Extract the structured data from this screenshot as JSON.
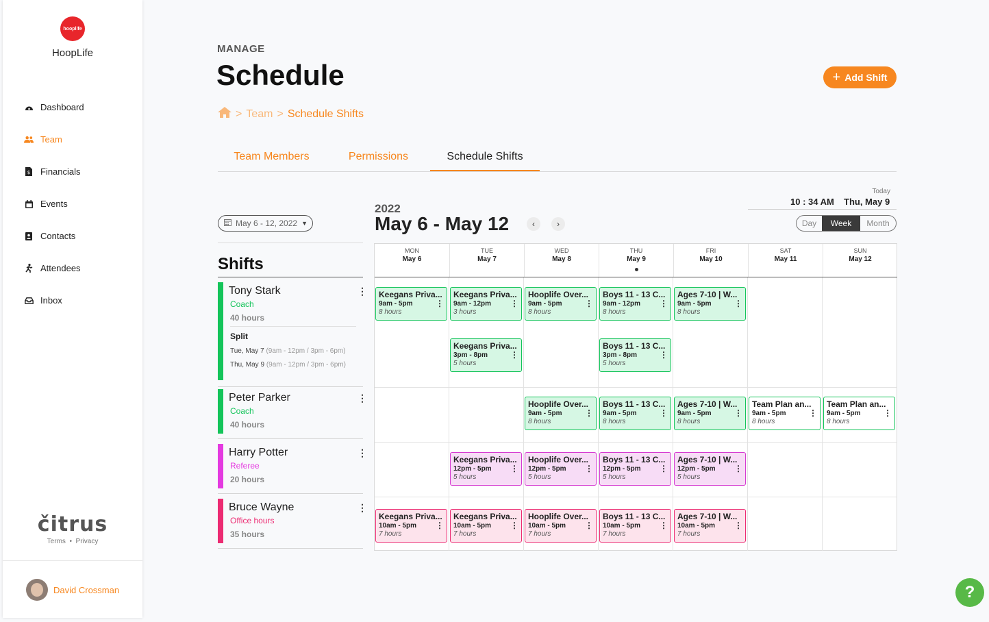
{
  "brand": {
    "logo_text": "hooplife",
    "name": "HoopLife"
  },
  "sidebar": {
    "items": [
      {
        "label": "Dashboard",
        "icon": "dashboard-icon"
      },
      {
        "label": "Team",
        "icon": "team-icon",
        "active": true
      },
      {
        "label": "Financials",
        "icon": "financials-icon"
      },
      {
        "label": "Events",
        "icon": "calendar-icon"
      },
      {
        "label": "Contacts",
        "icon": "contacts-icon"
      },
      {
        "label": "Attendees",
        "icon": "attendees-icon"
      },
      {
        "label": "Inbox",
        "icon": "inbox-icon"
      }
    ],
    "footer_logo": "čitrus",
    "terms": "Terms",
    "privacy": "Privacy",
    "user_name": "David Crossman"
  },
  "header": {
    "kicker": "MANAGE",
    "title": "Schedule",
    "add_button": "Add Shift",
    "breadcrumb": {
      "parent": "Team",
      "current": "Schedule Shifts",
      "sep": ">"
    }
  },
  "tabs": [
    "Team Members",
    "Permissions",
    "Schedule Shifts"
  ],
  "toolbar": {
    "date_picker": "May 6 - 12, 2022",
    "year": "2022",
    "range": "May 6 - May 12",
    "today_label": "Today",
    "time": "10 : 34 AM",
    "today_date": "Thu, May 9",
    "views": [
      "Day",
      "Week",
      "Month"
    ],
    "selected_view": "Week"
  },
  "shifts_panel": {
    "heading": "Shifts",
    "people": [
      {
        "name": "Tony Stark",
        "role": "Coach",
        "hours": "40 hours",
        "color": "#14c45a",
        "split": {
          "heading": "Split",
          "rows": [
            {
              "date": "Tue, May 7",
              "detail": "(9am - 12pm / 3pm - 6pm)"
            },
            {
              "date": "Thu, May 9",
              "detail": "(9am - 12pm / 3pm - 6pm)"
            }
          ]
        }
      },
      {
        "name": "Peter Parker",
        "role": "Coach",
        "hours": "40 hours",
        "color": "#14c45a"
      },
      {
        "name": "Harry Potter",
        "role": "Referee",
        "hours": "20 hours",
        "color": "#e43ae0"
      },
      {
        "name": "Bruce Wayne",
        "role": "Office hours",
        "hours": "35 hours",
        "color": "#ec2b72"
      }
    ]
  },
  "calendar": {
    "days": [
      {
        "dow": "MON",
        "date": "May 6"
      },
      {
        "dow": "TUE",
        "date": "May 7"
      },
      {
        "dow": "WED",
        "date": "May 8"
      },
      {
        "dow": "THU",
        "date": "May 9",
        "today": true
      },
      {
        "dow": "FRI",
        "date": "May 10"
      },
      {
        "dow": "SAT",
        "date": "May 11"
      },
      {
        "dow": "SUN",
        "date": "May 12"
      }
    ],
    "shifts": [
      {
        "day": 0,
        "slot": "tony-1",
        "title": "Keegans Priva...",
        "time": "9am - 5pm",
        "hours": "8 hours",
        "style": "coach"
      },
      {
        "day": 1,
        "slot": "tony-1",
        "title": "Keegans Priva...",
        "time": "9am - 12pm",
        "hours": "3 hours",
        "style": "coach"
      },
      {
        "day": 2,
        "slot": "tony-1",
        "title": "Hooplife Over...",
        "time": "9am - 5pm",
        "hours": "8 hours",
        "style": "coach"
      },
      {
        "day": 3,
        "slot": "tony-1",
        "title": "Boys 11 - 13 C...",
        "time": "9am - 12pm",
        "hours": "8 hours",
        "style": "coach"
      },
      {
        "day": 4,
        "slot": "tony-1",
        "title": "Ages 7-10 | W...",
        "time": "9am - 5pm",
        "hours": "8 hours",
        "style": "coach"
      },
      {
        "day": 1,
        "slot": "tony-2",
        "title": "Keegans Priva...",
        "time": "3pm - 8pm",
        "hours": "5 hours",
        "style": "coach"
      },
      {
        "day": 3,
        "slot": "tony-2",
        "title": "Boys 11 - 13 C...",
        "time": "3pm - 8pm",
        "hours": "5 hours",
        "style": "coach"
      },
      {
        "day": 2,
        "slot": "peter",
        "title": "Hooplife Over...",
        "time": "9am - 5pm",
        "hours": "8 hours",
        "style": "coach"
      },
      {
        "day": 3,
        "slot": "peter",
        "title": "Boys 11 - 13 C...",
        "time": "9am - 5pm",
        "hours": "8 hours",
        "style": "coach"
      },
      {
        "day": 4,
        "slot": "peter",
        "title": "Ages 7-10 | W...",
        "time": "9am - 5pm",
        "hours": "8 hours",
        "style": "coach"
      },
      {
        "day": 5,
        "slot": "peter",
        "title": "Team Plan an...",
        "time": "9am - 5pm",
        "hours": "8 hours",
        "style": "coach2"
      },
      {
        "day": 6,
        "slot": "peter",
        "title": "Team Plan an...",
        "time": "9am - 5pm",
        "hours": "8 hours",
        "style": "coach2"
      },
      {
        "day": 1,
        "slot": "harry",
        "title": "Keegans Priva...",
        "time": "12pm - 5pm",
        "hours": "5 hours",
        "style": "ref"
      },
      {
        "day": 2,
        "slot": "harry",
        "title": "Hooplife Over...",
        "time": "12pm - 5pm",
        "hours": "5 hours",
        "style": "ref"
      },
      {
        "day": 3,
        "slot": "harry",
        "title": "Boys 11 - 13 C...",
        "time": "12pm - 5pm",
        "hours": "5 hours",
        "style": "ref"
      },
      {
        "day": 4,
        "slot": "harry",
        "title": "Ages 7-10 | W...",
        "time": "12pm - 5pm",
        "hours": "5 hours",
        "style": "ref"
      },
      {
        "day": 0,
        "slot": "bruce",
        "title": "Keegans Priva...",
        "time": "10am - 5pm",
        "hours": "7 hours",
        "style": "office"
      },
      {
        "day": 1,
        "slot": "bruce",
        "title": "Keegans Priva...",
        "time": "10am - 5pm",
        "hours": "7 hours",
        "style": "office"
      },
      {
        "day": 2,
        "slot": "bruce",
        "title": "Hooplife Over...",
        "time": "10am - 5pm",
        "hours": "7 hours",
        "style": "office"
      },
      {
        "day": 3,
        "slot": "bruce",
        "title": "Boys 11 - 13 C...",
        "time": "10am - 5pm",
        "hours": "7 hours",
        "style": "office"
      },
      {
        "day": 4,
        "slot": "bruce",
        "title": "Ages 7-10 | W...",
        "time": "10am - 5pm",
        "hours": "7 hours",
        "style": "office"
      }
    ]
  },
  "help": "?"
}
